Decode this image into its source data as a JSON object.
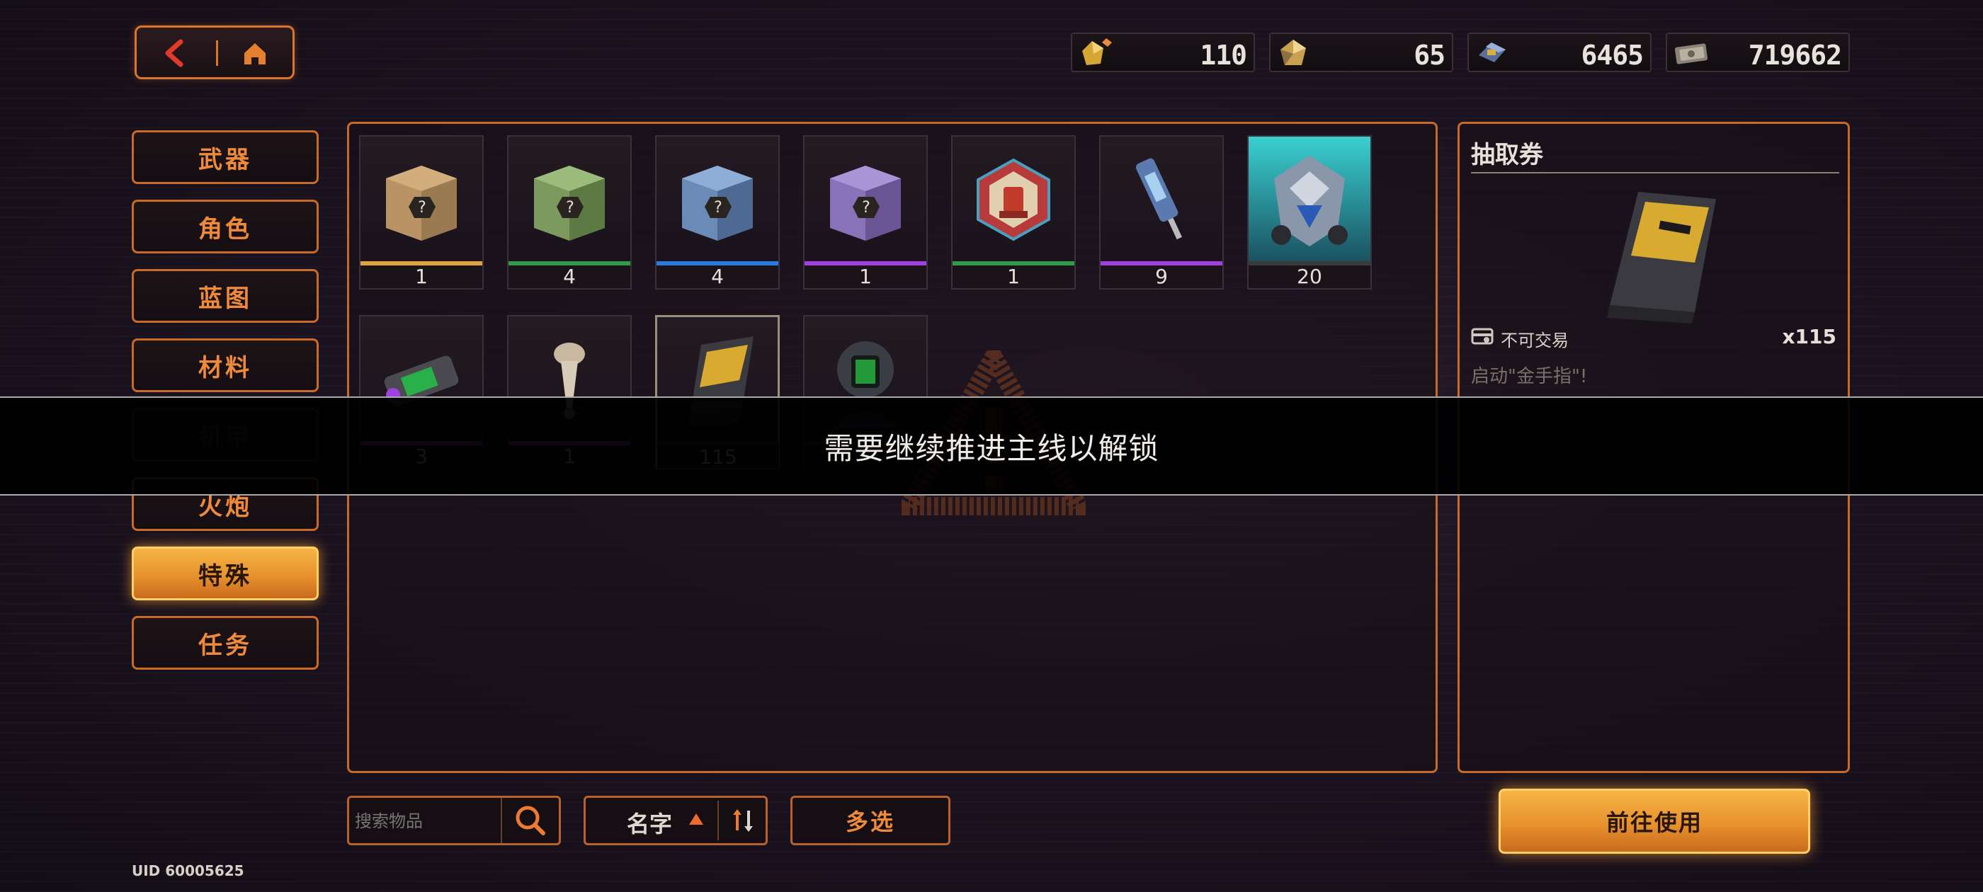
{
  "currencies": [
    {
      "icon": "gold-diamond-plus-icon",
      "value": "110"
    },
    {
      "icon": "gold-diamond-icon",
      "value": "65"
    },
    {
      "icon": "blue-chip-icon",
      "value": "6465"
    },
    {
      "icon": "banknote-icon",
      "value": "719662"
    }
  ],
  "categories": [
    {
      "label": "武器"
    },
    {
      "label": "角色"
    },
    {
      "label": "蓝图"
    },
    {
      "label": "材料"
    },
    {
      "label": "机甲"
    },
    {
      "label": "火炮"
    },
    {
      "label": "特殊"
    },
    {
      "label": "任务"
    }
  ],
  "items": [
    {
      "name": "brown-mystery-box",
      "count": "1",
      "rarity_color": "#e0a23a"
    },
    {
      "name": "green-mystery-box",
      "count": "4",
      "rarity_color": "#2f9a4a"
    },
    {
      "name": "blue-mystery-box",
      "count": "4",
      "rarity_color": "#2a7ae0"
    },
    {
      "name": "purple-mystery-box",
      "count": "1",
      "rarity_color": "#a040e0"
    },
    {
      "name": "red-hex-emblem",
      "count": "1",
      "rarity_color": "#2f9a4a"
    },
    {
      "name": "injector-syringe",
      "count": "9",
      "rarity_color": "#a040e0"
    },
    {
      "name": "mech-head",
      "count": "20",
      "rarity_color": "#3a3a3a"
    },
    {
      "name": "battery-module",
      "count": "3",
      "rarity_color": "#a040e0"
    },
    {
      "name": "antenna-spike",
      "count": "1",
      "rarity_color": "#a040e0"
    },
    {
      "name": "draw-ticket",
      "count": "115",
      "rarity_color": "#3a3a3a"
    },
    {
      "name": "robot-avatar",
      "count": "",
      "rarity_color": "#3a3a3a"
    }
  ],
  "info": {
    "title": "抽取券",
    "trade_status": "不可交易",
    "quantity": "x115",
    "description": "启动\"金手指\"!"
  },
  "banner": {
    "message": "需要继续推进主线以解锁"
  },
  "controls": {
    "search_placeholder": "搜索物品",
    "sort_label": "名字",
    "multi_select": "多选",
    "use_button": "前往使用"
  },
  "uid": "UID 60005625",
  "colors": {
    "accent": "#ef8a3a",
    "active_fill": "#f0a63a",
    "border": "#c66a2a"
  }
}
